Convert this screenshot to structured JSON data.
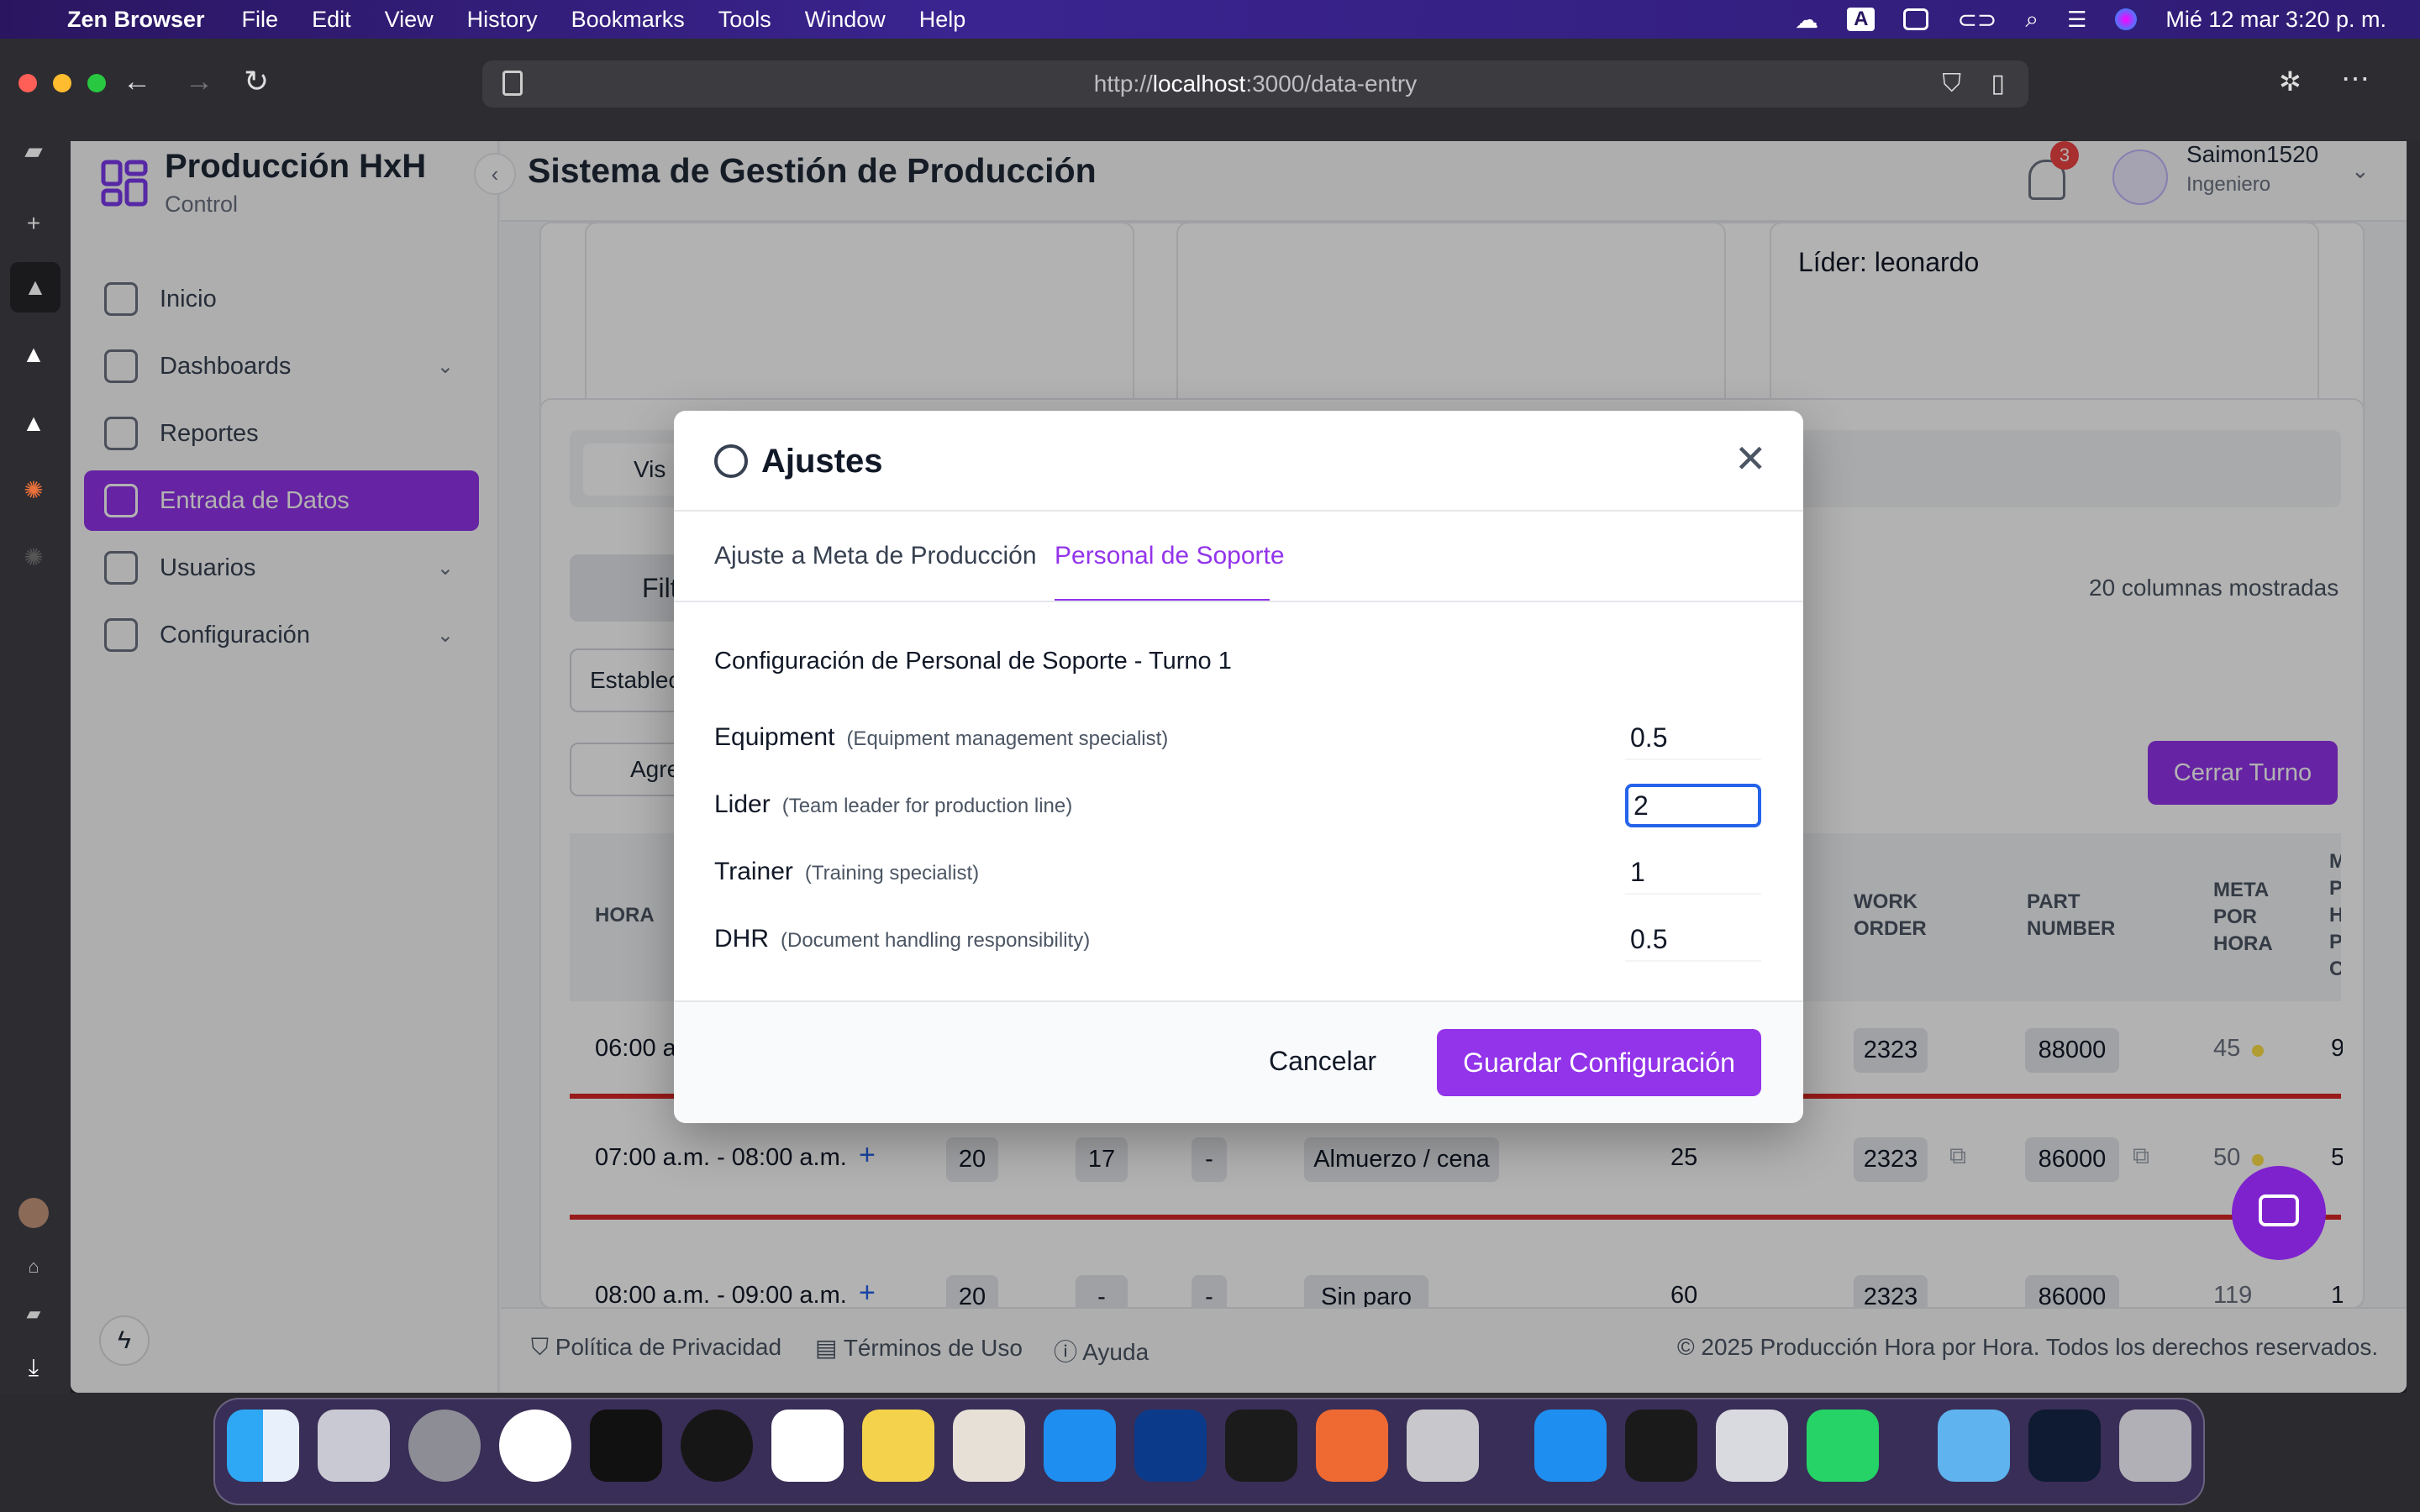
{
  "menubar": {
    "app": "Zen Browser",
    "menus": [
      "File",
      "Edit",
      "View",
      "History",
      "Bookmarks",
      "Tools",
      "Window",
      "Help"
    ],
    "keyboard_indicator": "A",
    "datetime": "Mié 12 mar 3:20 p. m."
  },
  "browser": {
    "url_prefix": "http://",
    "url_host": "localhost",
    "url_rest": ":3000/data-entry"
  },
  "sidebar": {
    "brand_title": "Producción HxH",
    "brand_sub": "Control",
    "items": [
      {
        "label": "Inicio"
      },
      {
        "label": "Dashboards"
      },
      {
        "label": "Reportes"
      },
      {
        "label": "Entrada de Datos"
      },
      {
        "label": "Usuarios"
      },
      {
        "label": "Configuración"
      }
    ]
  },
  "header": {
    "title": "Sistema de Gestión de Producción",
    "notifications": "3",
    "user_name": "Saimon1520",
    "user_role": "Ingeniero"
  },
  "page": {
    "lider_text": "Líder: leonardo",
    "view_tab_partial": "Vis",
    "filter_partial": "Filt",
    "establecimiento_partial": "Establec",
    "agregar_partial": "Agre",
    "columns_shown": "20 columnas mostradas",
    "close_shift": "Cerrar Turno",
    "table_headers": {
      "hora": "HORA",
      "work_order": "WORK ORDER",
      "part_number": "PART NUMBER",
      "meta_por_hora": "META POR HORA",
      "partial_col": "M P H P C"
    },
    "rows": [
      {
        "hora": "06:00 a",
        "work_order": "2323",
        "part_number": "88000",
        "meta": "45",
        "extra": "9"
      },
      {
        "hora": "07:00 a.m. - 08:00 a.m.",
        "c1": "20",
        "c2": "17",
        "c3": "-",
        "paro": "Almuerzo / cena",
        "val": "25",
        "work_order": "2323",
        "part_number": "86000",
        "meta": "50",
        "extra": "5"
      },
      {
        "hora": "08:00 a.m. - 09:00 a.m.",
        "c1": "20",
        "c2": "-",
        "c3": "-",
        "paro": "Sin paro",
        "val": "60",
        "work_order": "2323",
        "part_number": "86000",
        "meta": "119",
        "extra": "1"
      }
    ]
  },
  "footer": {
    "privacy": "Política de Privacidad",
    "terms": "Términos de Uso",
    "help": "Ayuda",
    "copyright": "© 2025 Producción Hora por Hora. Todos los derechos reservados."
  },
  "modal": {
    "title": "Ajustes",
    "tabs": [
      {
        "label": "Ajuste a Meta de Producción",
        "active": false
      },
      {
        "label": "Personal de Soporte",
        "active": true
      }
    ],
    "section_title": "Configuración de Personal de Soporte - Turno 1",
    "rows": [
      {
        "label": "Equipment",
        "desc": "(Equipment management specialist)",
        "value": "0.5"
      },
      {
        "label": "Lider",
        "desc": "(Team leader for production line)",
        "value": "2"
      },
      {
        "label": "Trainer",
        "desc": "(Training specialist)",
        "value": "1"
      },
      {
        "label": "DHR",
        "desc": "(Document handling responsibility)",
        "value": "0.5"
      }
    ],
    "cancel": "Cancelar",
    "save": "Guardar Configuración"
  },
  "colors": {
    "accent": "#9333ea",
    "danger": "#dc2626",
    "focus": "#2563eb"
  }
}
